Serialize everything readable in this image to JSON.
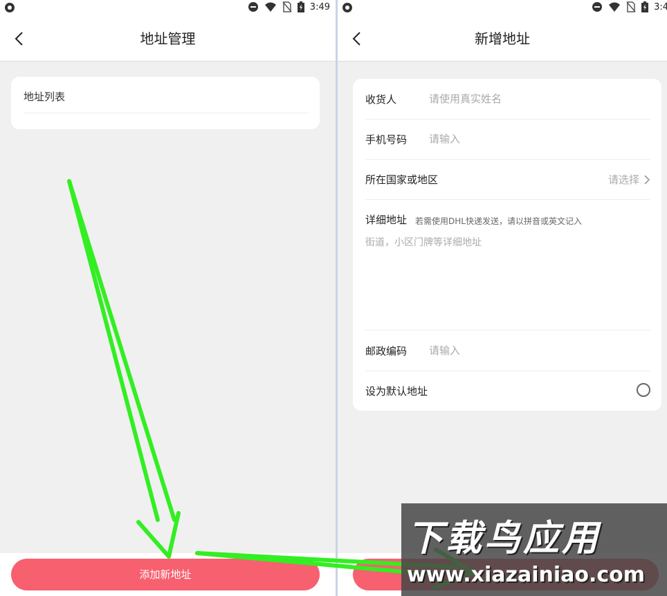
{
  "status_bar": {
    "time": "3:49",
    "time_right": "3:4"
  },
  "left": {
    "title": "地址管理",
    "list_title": "地址列表",
    "add_button": "添加新地址"
  },
  "right": {
    "title": "新增地址",
    "fields": {
      "recipient": {
        "label": "收货人",
        "placeholder": "请使用真实姓名"
      },
      "phone": {
        "label": "手机号码",
        "placeholder": "请输入"
      },
      "region": {
        "label": "所在国家或地区",
        "placeholder": "请选择"
      },
      "address": {
        "label": "详细地址",
        "hint": "若需使用DHL快递发送，请以拼音或英文记入",
        "placeholder": "街道，小区门牌等详细地址"
      },
      "postcode": {
        "label": "邮政编码",
        "placeholder": "请输入"
      },
      "default": {
        "label": "设为默认地址"
      }
    }
  },
  "watermark": {
    "title": "下载鸟应用",
    "url": "www.xiazainiao.com"
  },
  "colors": {
    "primary": "#f7606f",
    "annotation_arrow": "#33ee22"
  }
}
